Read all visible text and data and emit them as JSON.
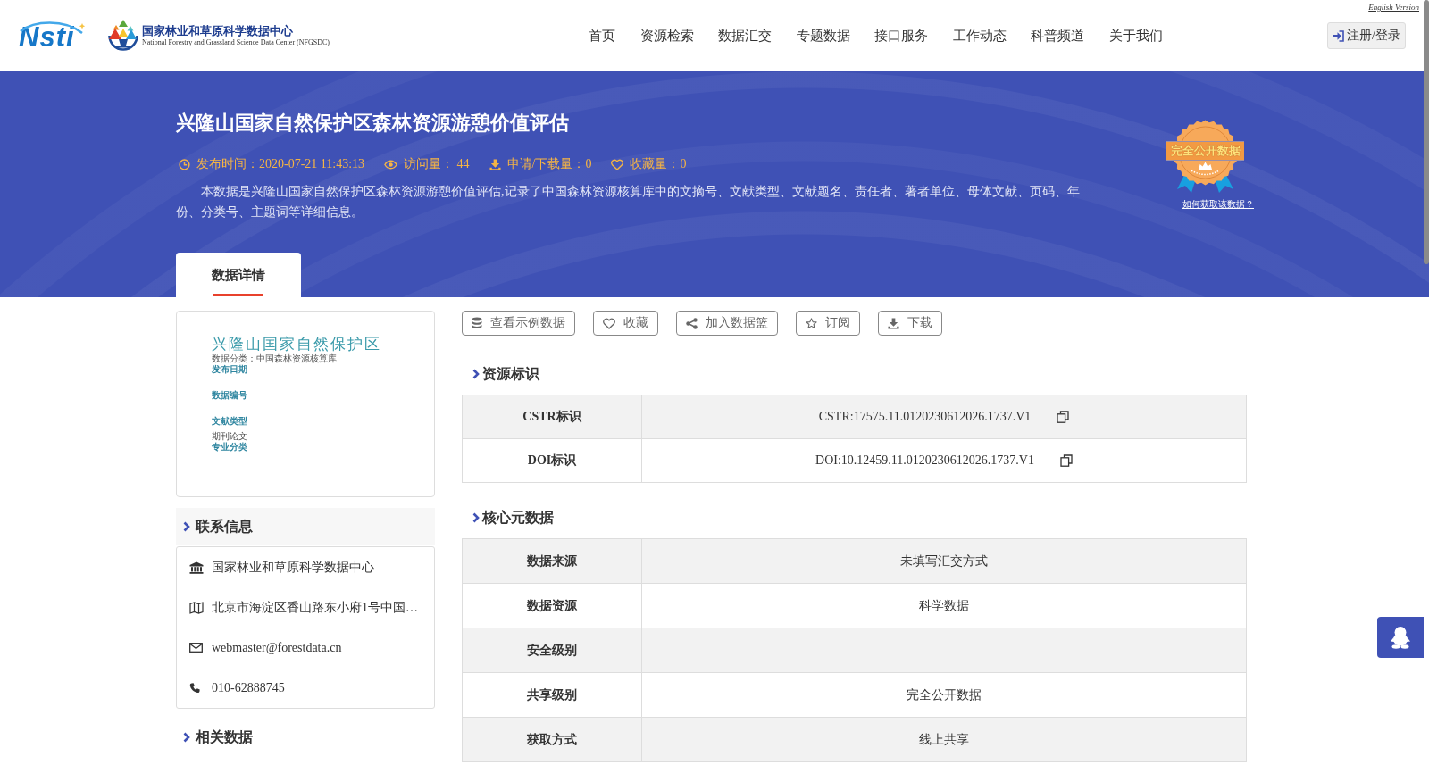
{
  "header": {
    "logo_text": "Nsti",
    "center_name": "国家林业和草原科学数据中心",
    "center_name_en": "National Forestry and Grassland Science Data Center (NFGSDC)",
    "english_link": "English Version",
    "nav": [
      "首页",
      "资源检索",
      "数据汇交",
      "专题数据",
      "接口服务",
      "工作动态",
      "科普频道",
      "关于我们"
    ],
    "login_button": "注册/登录"
  },
  "banner": {
    "title": "兴隆山国家自然保护区森林资源游憩价值评估",
    "meta": [
      {
        "kind": "time",
        "text": "发布时间：2020-07-21 11:43:13"
      },
      {
        "kind": "views",
        "text": "访问量： 44"
      },
      {
        "kind": "downloads",
        "text": "申请/下载量：0"
      },
      {
        "kind": "favorites",
        "text": "收藏量：0"
      }
    ],
    "description": "本数据是兴隆山国家自然保护区森林资源游憩价值评估,记录了中国森林资源核算库中的文摘号、文献类型、文献题名、责任者、著者单位、母体文献、页码、年份、分类号、主题词等详细信息。",
    "badge": {
      "label": "完全公开数据",
      "help_link": "如何获取该数据？"
    }
  },
  "tabs": [
    {
      "label": "数据详情",
      "selected": true
    }
  ],
  "cover": {
    "title": "兴隆山国家自然保护区",
    "subtitle": "数据分类：中国森林资源核算库",
    "fields": [
      {
        "label": "发布日期"
      },
      {
        "label": "数据编号"
      },
      {
        "label": "文献类型",
        "value": "期刊论文"
      },
      {
        "label": "专业分类"
      }
    ]
  },
  "contact": {
    "title": "联系信息",
    "items": [
      {
        "kind": "institution",
        "text": "国家林业和草原科学数据中心"
      },
      {
        "kind": "address",
        "text": "北京市海淀区香山路东小府1号中国…"
      },
      {
        "kind": "email",
        "text": "webmaster@forestdata.cn"
      },
      {
        "kind": "phone",
        "text": "010-62888745"
      }
    ]
  },
  "related": {
    "title": "相关数据"
  },
  "actions": [
    {
      "kind": "sample",
      "label": "查看示例数据"
    },
    {
      "kind": "favorite",
      "label": "收藏"
    },
    {
      "kind": "basket",
      "label": "加入数据篮"
    },
    {
      "kind": "subscribe",
      "label": "订阅"
    },
    {
      "kind": "download",
      "label": "下载"
    }
  ],
  "identifiers": {
    "title": "资源标识",
    "rows": [
      {
        "label": "CSTR标识",
        "value": "CSTR:17575.11.0120230612026.1737.V1"
      },
      {
        "label": "DOI标识",
        "value": "DOI:10.12459.11.0120230612026.1737.V1"
      }
    ]
  },
  "core_metadata": {
    "title": "核心元数据",
    "rows": [
      {
        "label": "数据来源",
        "value": "未填写汇交方式"
      },
      {
        "label": "数据资源",
        "value": "科学数据"
      },
      {
        "label": "安全级别"
      },
      {
        "label": "共享级别",
        "value": "完全公开数据"
      },
      {
        "label": "获取方式",
        "value": "线上共享"
      }
    ]
  }
}
